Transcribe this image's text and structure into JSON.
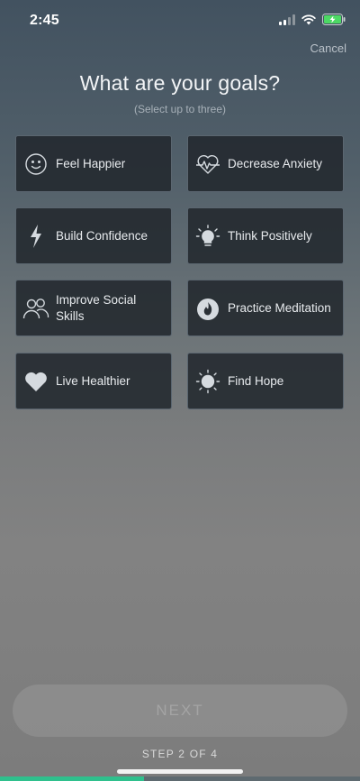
{
  "status_bar": {
    "time": "2:45"
  },
  "header": {
    "cancel_label": "Cancel",
    "title": "What are your goals?",
    "subtitle": "(Select up to three)"
  },
  "goals": [
    {
      "label": "Feel Happier",
      "icon": "smile-icon"
    },
    {
      "label": "Decrease Anxiety",
      "icon": "heartbeat-icon"
    },
    {
      "label": "Build Confidence",
      "icon": "lightning-icon"
    },
    {
      "label": "Think Positively",
      "icon": "lightbulb-icon"
    },
    {
      "label": "Improve Social Skills",
      "icon": "people-icon"
    },
    {
      "label": "Practice Meditation",
      "icon": "flame-icon"
    },
    {
      "label": "Live Healthier",
      "icon": "heart-icon"
    },
    {
      "label": "Find Hope",
      "icon": "sun-icon"
    }
  ],
  "footer": {
    "next_label": "NEXT",
    "step_label": "STEP 2 OF 4",
    "progress": 0.4
  },
  "colors": {
    "accent": "#2fc08d",
    "card_background": "#22282e",
    "card_border": "#5b6670"
  }
}
